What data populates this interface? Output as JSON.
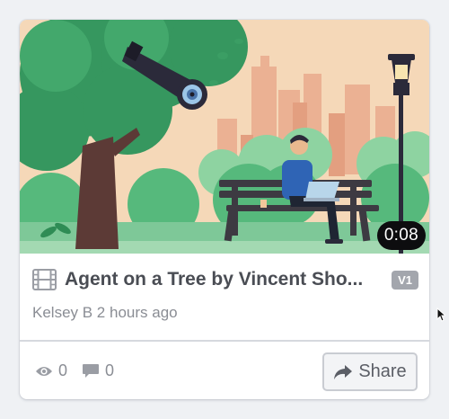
{
  "card": {
    "duration": "0:08",
    "title": "Agent on a Tree by Vincent Sho...",
    "version_badge": "V1",
    "meta": "Kelsey B 2 hours ago",
    "views": "0",
    "comments": "0",
    "share_label": "Share"
  },
  "icons": [
    "film-icon",
    "eye-icon",
    "comment-icon",
    "share-arrow-icon",
    "mouse-cursor-icon"
  ],
  "colors": {
    "sky": "#f4d6b6",
    "foliage": "#3fa86b",
    "badge": "#a3a6ad",
    "title": "#4a4d54",
    "muted": "#8a8d94"
  }
}
